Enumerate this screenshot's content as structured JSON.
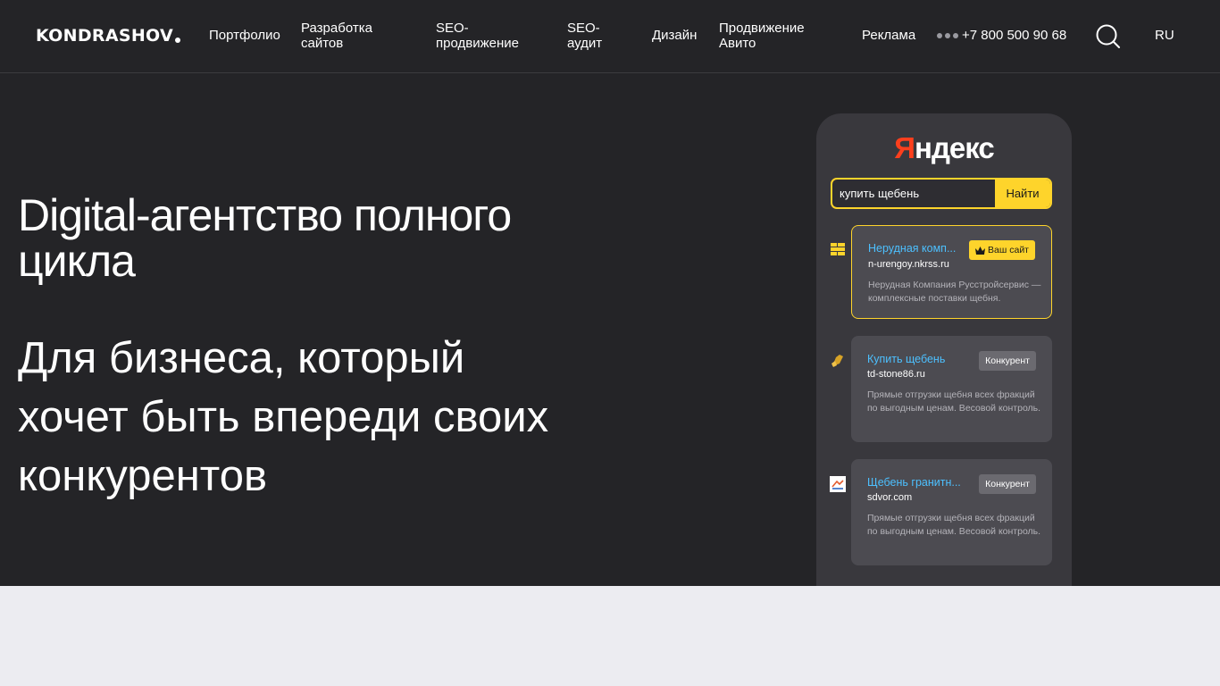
{
  "header": {
    "logo": "KONDRASHOV",
    "nav": [
      {
        "label": "Портфолио"
      },
      {
        "label": "Разработка сайтов"
      },
      {
        "label": "SEO-продвижение"
      },
      {
        "label": "SEO-аудит"
      },
      {
        "label": "Дизайн"
      },
      {
        "label": "Продвижение Авито"
      },
      {
        "label": "Реклама"
      }
    ],
    "phone": "+7 800 500 90 68",
    "search_icon": "search-icon",
    "lang": "RU"
  },
  "hero": {
    "title": "Digital-агентство полного цикла",
    "subtitle": "Для бизнеса, который хочет быть впереди своих конкурентов"
  },
  "mock": {
    "brand_first": "Я",
    "brand_rest": "ндекс",
    "query": "купить щебень",
    "search_button": "Найти",
    "results": [
      {
        "title": "Нерудная комп...",
        "url": "n-urengoy.nkrss.ru",
        "description": "Нерудная Компания Русстройсервис — комплексные поставки щебня.",
        "badge": "Ваш сайт",
        "own": true,
        "favicon": "bricks-icon"
      },
      {
        "title": "Купить щебень",
        "url": "td-stone86.ru",
        "description": "Прямые отгрузки щебня всех фракций по выгодным ценам. Весовой контроль.",
        "badge": "Конкурент",
        "own": false,
        "favicon": "stone-icon"
      },
      {
        "title": "Щебень гранитн...",
        "url": "sdvor.com",
        "description": "Прямые отгрузки щебня всех фракций по выгодным ценам. Весовой контроль.",
        "badge": "Конкурент",
        "own": false,
        "favicon": "house-icon"
      }
    ]
  },
  "bottom": {
    "heading": ""
  },
  "colors": {
    "background": "#242427",
    "accent": "#fed42b",
    "link": "#4cc0ff",
    "yandex_red": "#fc3f1d",
    "bottom_bg": "#ececf1"
  }
}
